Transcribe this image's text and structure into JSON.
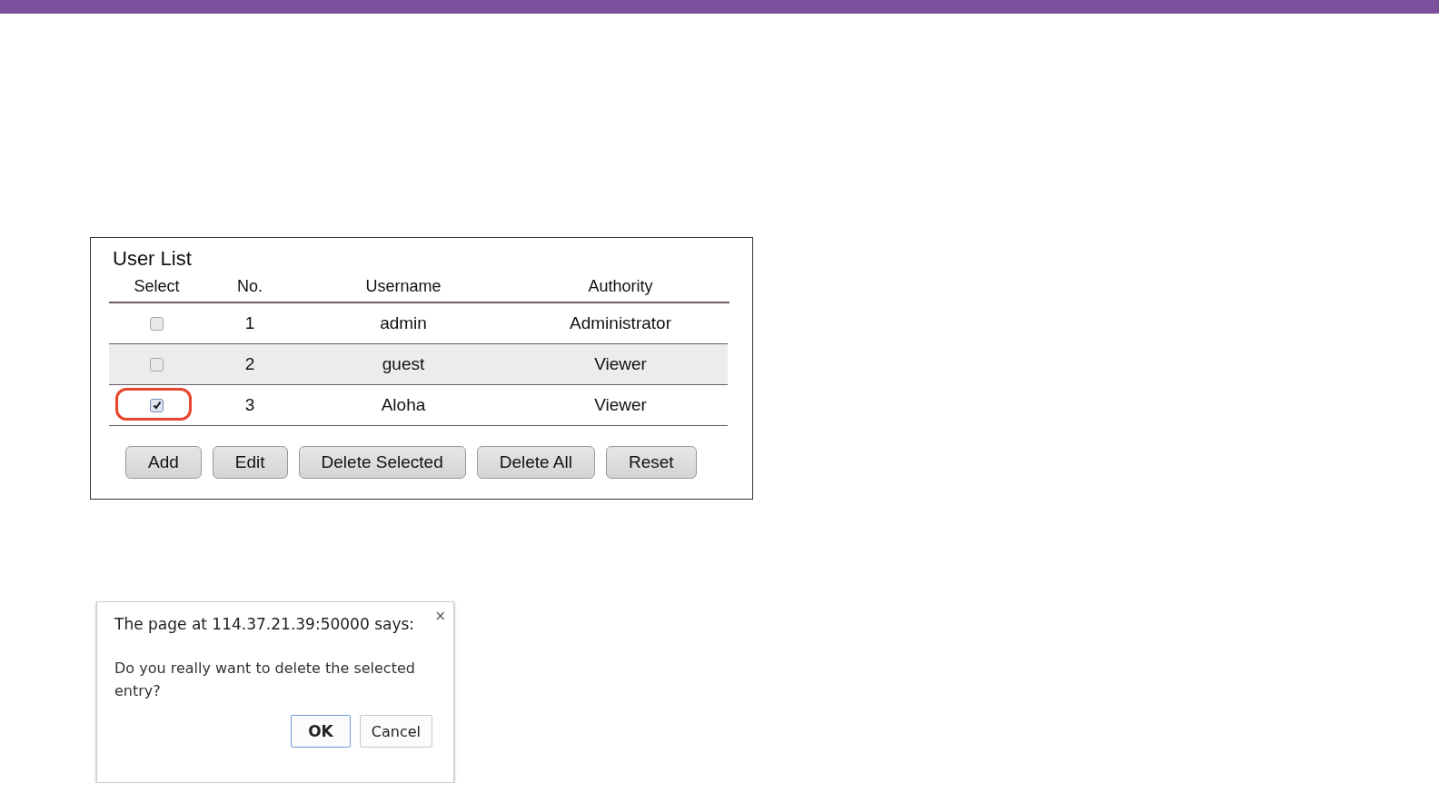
{
  "user_list": {
    "title": "User List",
    "columns": [
      "Select",
      "No.",
      "Username",
      "Authority"
    ],
    "rows": [
      {
        "checked": false,
        "highlighted": false,
        "striped": false,
        "no": "1",
        "username": "admin",
        "authority": "Administrator"
      },
      {
        "checked": false,
        "highlighted": false,
        "striped": true,
        "no": "2",
        "username": "guest",
        "authority": "Viewer"
      },
      {
        "checked": true,
        "highlighted": true,
        "striped": false,
        "no": "3",
        "username": "Aloha",
        "authority": "Viewer"
      }
    ],
    "buttons": [
      "Add",
      "Edit",
      "Delete Selected",
      "Delete All",
      "Reset"
    ]
  },
  "dialog": {
    "title": "The page at 114.37.21.39:50000 says:",
    "close": "×",
    "message": "Do you really want to delete the selected entry?",
    "buttons": [
      {
        "label": "OK",
        "default": true
      },
      {
        "label": "Cancel",
        "default": false
      }
    ]
  }
}
